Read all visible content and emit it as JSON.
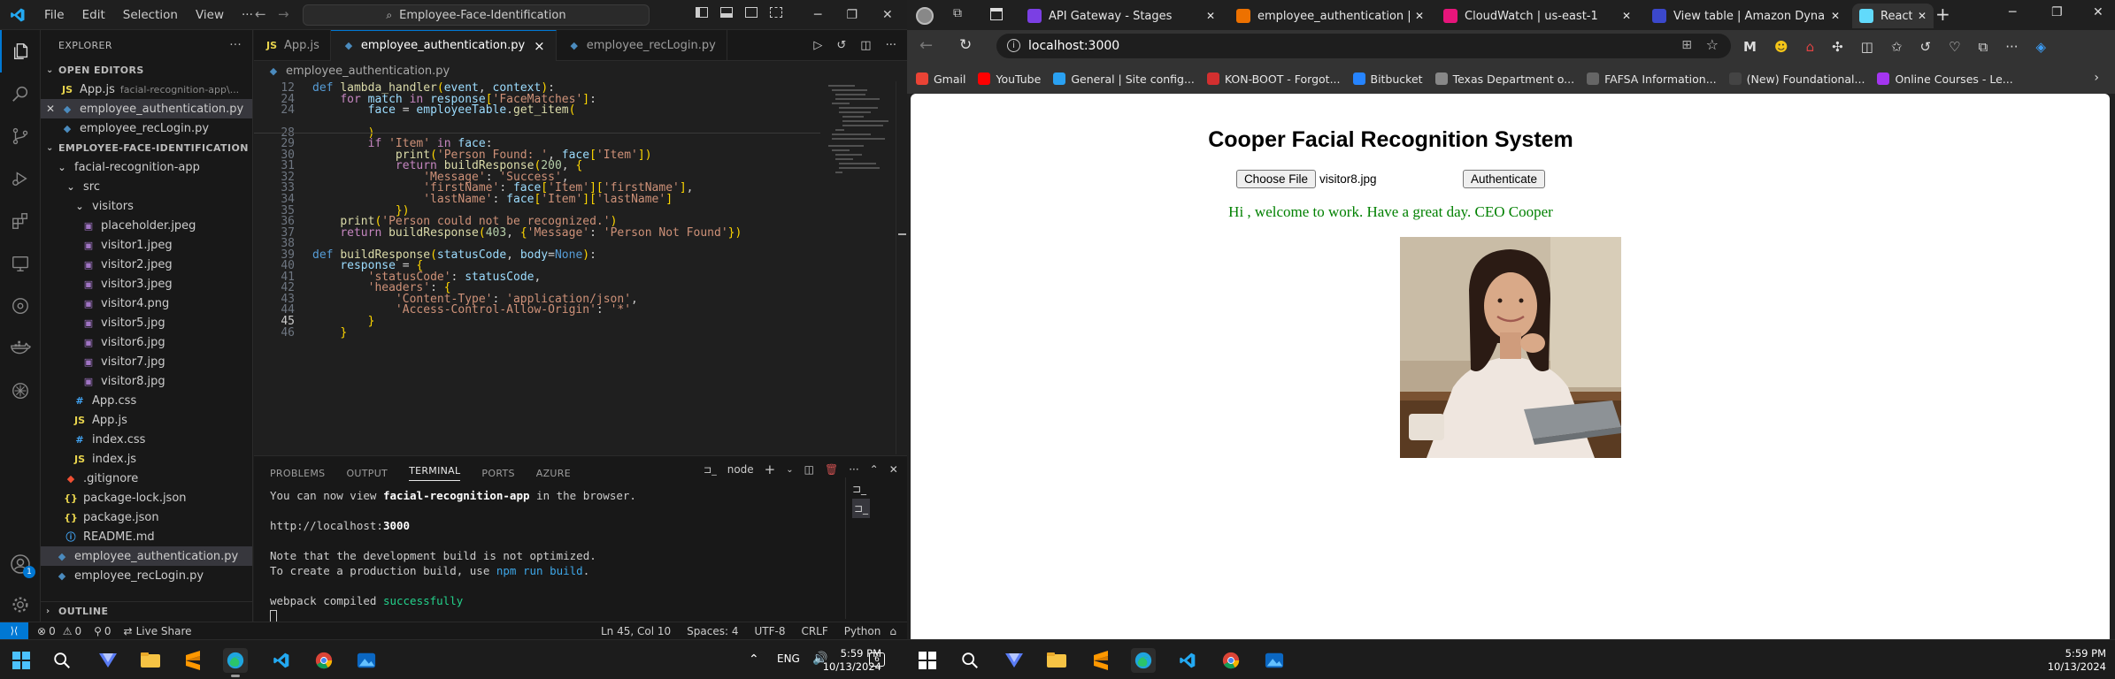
{
  "vscode": {
    "menus": [
      "File",
      "Edit",
      "Selection",
      "View",
      "···"
    ],
    "command_center": "Employee-Face-Identification",
    "tabs": [
      {
        "label": "App.js",
        "icon": "JS"
      },
      {
        "label": "employee_authentication.py",
        "icon": "py",
        "close": "×"
      },
      {
        "label": "employee_recLogin.py",
        "icon": "py"
      }
    ],
    "breadcrumb": "employee_authentication.py",
    "explorer": {
      "title": "EXPLORER",
      "open_editors_label": "OPEN EDITORS",
      "open_editors": [
        {
          "name": "App.js",
          "hint": "facial-recognition-app\\..."
        },
        {
          "name": "employee_authentication.py",
          "hint": ""
        },
        {
          "name": "employee_recLogin.py",
          "hint": ""
        }
      ],
      "project_label": "EMPLOYEE-FACE-IDENTIFICATION",
      "tree": [
        {
          "name": "facial-recognition-app",
          "depth": 1,
          "type": "folder"
        },
        {
          "name": "src",
          "depth": 2,
          "type": "folder"
        },
        {
          "name": "visitors",
          "depth": 3,
          "type": "folder"
        },
        {
          "name": "placeholder.jpeg",
          "depth": 4,
          "type": "img"
        },
        {
          "name": "visitor1.jpeg",
          "depth": 4,
          "type": "img"
        },
        {
          "name": "visitor2.jpeg",
          "depth": 4,
          "type": "img"
        },
        {
          "name": "visitor3.jpeg",
          "depth": 4,
          "type": "img"
        },
        {
          "name": "visitor4.png",
          "depth": 4,
          "type": "img"
        },
        {
          "name": "visitor5.jpg",
          "depth": 4,
          "type": "img"
        },
        {
          "name": "visitor6.jpg",
          "depth": 4,
          "type": "img"
        },
        {
          "name": "visitor7.jpg",
          "depth": 4,
          "type": "img"
        },
        {
          "name": "visitor8.jpg",
          "depth": 4,
          "type": "img"
        },
        {
          "name": "App.css",
          "depth": 3,
          "type": "css"
        },
        {
          "name": "App.js",
          "depth": 3,
          "type": "js"
        },
        {
          "name": "index.css",
          "depth": 3,
          "type": "css"
        },
        {
          "name": "index.js",
          "depth": 3,
          "type": "js"
        },
        {
          "name": ".gitignore",
          "depth": 2,
          "type": "git"
        },
        {
          "name": "package-lock.json",
          "depth": 2,
          "type": "json"
        },
        {
          "name": "package.json",
          "depth": 2,
          "type": "json"
        },
        {
          "name": "README.md",
          "depth": 2,
          "type": "info"
        },
        {
          "name": "employee_authentication.py",
          "depth": 1,
          "type": "py",
          "selected": true
        },
        {
          "name": "employee_recLogin.py",
          "depth": 1,
          "type": "py"
        }
      ],
      "outline_label": "OUTLINE"
    },
    "code_lines": [
      {
        "n": "12",
        "t": "def lambda_handler(event, context):"
      },
      {
        "n": "24",
        "t": "    for match in response['FaceMatches']:"
      },
      {
        "n": "24",
        "t": "        face = employeeTable.get_item("
      },
      {
        "n": "28",
        "t": "        )"
      },
      {
        "n": "29",
        "t": "        if 'Item' in face:"
      },
      {
        "n": "30",
        "t": "            print('Person Found: ', face['Item'])"
      },
      {
        "n": "31",
        "t": "            return buildResponse(200, {"
      },
      {
        "n": "32",
        "t": "                'Message': 'Success',"
      },
      {
        "n": "33",
        "t": "                'firstName': face['Item']['firstName'],"
      },
      {
        "n": "34",
        "t": "                'lastName': face['Item']['lastName']"
      },
      {
        "n": "35",
        "t": "            })"
      },
      {
        "n": "36",
        "t": "    print('Person could not be recognized.')"
      },
      {
        "n": "37",
        "t": "    return buildResponse(403, {'Message': 'Person Not Found'})"
      },
      {
        "n": "38",
        "t": ""
      },
      {
        "n": "39",
        "t": "def buildResponse(statusCode, body=None):"
      },
      {
        "n": "40",
        "t": "    response = {"
      },
      {
        "n": "41",
        "t": "        'statusCode': statusCode,"
      },
      {
        "n": "42",
        "t": "        'headers': {"
      },
      {
        "n": "43",
        "t": "            'Content-Type': 'application/json',"
      },
      {
        "n": "44",
        "t": "            'Access-Control-Allow-Origin': '*'"
      },
      {
        "n": "45",
        "t": "        }"
      },
      {
        "n": "46",
        "t": "    }"
      }
    ],
    "panel": {
      "tabs": [
        "PROBLEMS",
        "OUTPUT",
        "TERMINAL",
        "PORTS",
        "AZURE"
      ],
      "active_tab": "TERMINAL",
      "terminal_name": "node",
      "terminal": {
        "l1a": "You can now view ",
        "l1b": "facial-recognition-app",
        "l1c": " in the browser.",
        "l2a": "  http://localhost:",
        "l2b": "3000",
        "l3": "Note that the development build is not optimized.",
        "l4a": "To create a production build, use ",
        "l4b": "npm run build",
        "l4c": ".",
        "l5a": "webpack compiled ",
        "l5b": "successfully"
      }
    },
    "status": {
      "errors": "0",
      "warnings": "0",
      "ports": "0",
      "live_share": "Live Share",
      "position": "Ln 45, Col 10",
      "spaces": "Spaces: 4",
      "encoding": "UTF-8",
      "eol": "CRLF",
      "language": "Python"
    }
  },
  "browser": {
    "tabs": [
      {
        "label": "API Gateway - Stages",
        "color": "#7b3fe4"
      },
      {
        "label": "employee_authentication |",
        "color": "#ed7100"
      },
      {
        "label": "CloudWatch | us-east-1",
        "color": "#e7157b"
      },
      {
        "label": "View table | Amazon Dyna",
        "color": "#3b48cc"
      },
      {
        "label": "React App",
        "color": "#61dafb",
        "active": true
      }
    ],
    "url": "localhost:3000",
    "bookmarks": [
      {
        "label": "Gmail",
        "color": "#ea4335"
      },
      {
        "label": "YouTube",
        "color": "#ff0000"
      },
      {
        "label": "General | Site config...",
        "color": "#2aa1f2"
      },
      {
        "label": "KON-BOOT - Forgot...",
        "color": "#d32f2f"
      },
      {
        "label": "Bitbucket",
        "color": "#2684ff"
      },
      {
        "label": "Texas Department o...",
        "color": "#888888"
      },
      {
        "label": "FAFSA Information...",
        "color": "#666666"
      },
      {
        "label": "(New) Foundational...",
        "color": "#444444"
      },
      {
        "label": "Online Courses - Le...",
        "color": "#a435f0"
      }
    ],
    "app": {
      "title": "Cooper Facial Recognition System",
      "choose_file": "Choose File",
      "file_name": "visitor8.jpg",
      "authenticate": "Authenticate",
      "message": "Hi , welcome to work. Have a great day. CEO Cooper"
    }
  },
  "taskbar": {
    "left": {
      "time": "5:59 PM",
      "date": "10/13/2024",
      "lang": "ENG"
    },
    "right": {
      "time": "5:59 PM",
      "date": "10/13/2024"
    }
  }
}
